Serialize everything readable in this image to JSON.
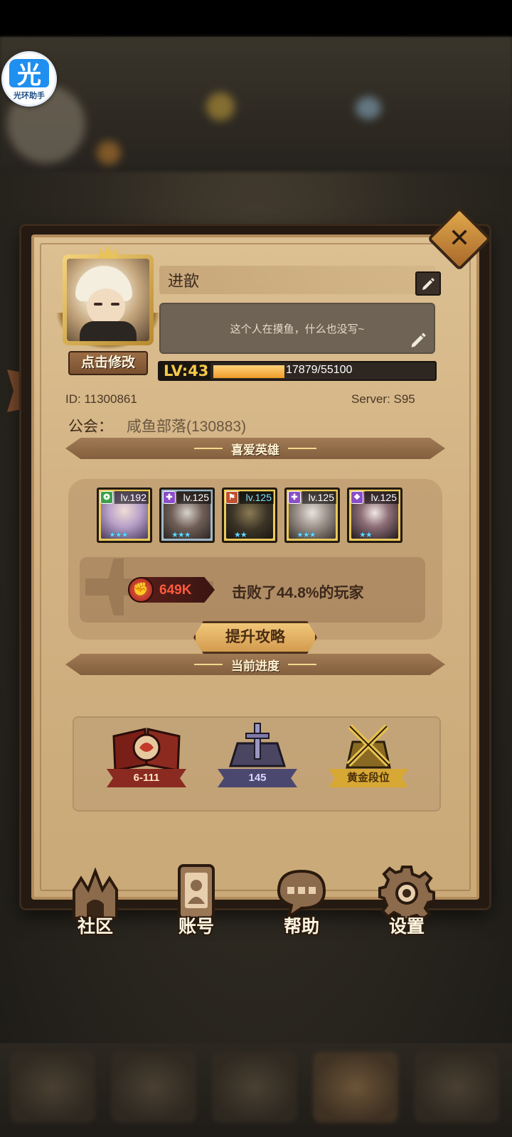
{
  "overlay_badge": {
    "glyph": "光",
    "caption": "光环助手"
  },
  "profile": {
    "name": "进歆",
    "bio": "这个人在摸鱼，什么也没写~",
    "edit_button": "点击修改",
    "level_label": "LV:43",
    "exp_text": "17879/55100",
    "exp_progress": 0.324,
    "id_text": "ID:  11300861",
    "server_text": "Server:  S95",
    "guild_label": "公会：",
    "guild_value": "咸鱼部落(130883)"
  },
  "sections": {
    "favorite_heroes": "喜爱英雄",
    "current_progress": "当前进度"
  },
  "heroes": [
    {
      "level": "lv.192",
      "faction_color": "#3aa04a",
      "lv_color": "#ffffff",
      "stars": "★★★"
    },
    {
      "level": "lv.125",
      "faction_color": "#8a4ec7",
      "lv_color": "#ffffff",
      "stars": "★★★"
    },
    {
      "level": "lv.125",
      "faction_color": "#c2502e",
      "lv_color": "#7ee2ff",
      "stars": "★★"
    },
    {
      "level": "lv.125",
      "faction_color": "#8a4ec7",
      "lv_color": "#ffffff",
      "stars": "★★★"
    },
    {
      "level": "lv.125",
      "faction_color": "#8a4ec7",
      "lv_color": "#ffffff",
      "stars": "★★"
    }
  ],
  "power": {
    "value": "649K",
    "defeat_text": "击败了44.8%的玩家",
    "strategy_button": "提升攻略"
  },
  "progress": [
    {
      "label": "6-111",
      "icon": "campaign-book-icon",
      "color": "#c23a2a"
    },
    {
      "label": "145",
      "icon": "tower-sword-icon",
      "color": "#6c6a9a"
    },
    {
      "label": "黄金段位",
      "icon": "gold-rank-crossed-swords-icon",
      "color": "#e2b23c"
    }
  ],
  "menu": [
    {
      "label": "社区",
      "icon": "castle-icon"
    },
    {
      "label": "账号",
      "icon": "account-card-icon"
    },
    {
      "label": "帮助",
      "icon": "chat-bubble-icon"
    },
    {
      "label": "设置",
      "icon": "gear-icon"
    }
  ],
  "colors": {
    "panel": "#d3b384",
    "accent_orange": "#ee9b2a",
    "power_red": "#ff5a3e"
  }
}
